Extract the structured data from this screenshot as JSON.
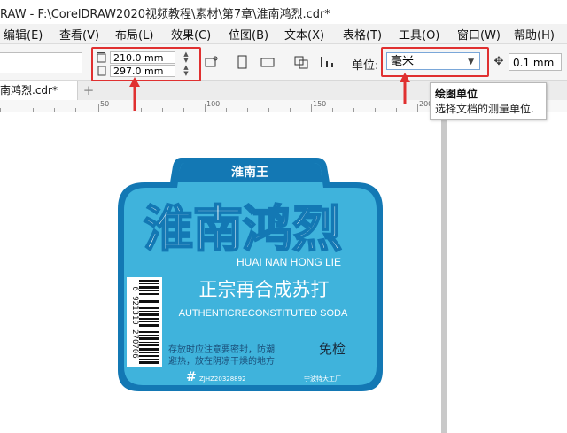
{
  "app": {
    "title": "RAW - F:\\CorelDRAW2020视频教程\\素材\\第7章\\淮南鸿烈.cdr*"
  },
  "menu": [
    {
      "label": "编辑(E)"
    },
    {
      "label": "查看(V)"
    },
    {
      "label": "布局(L)"
    },
    {
      "label": "效果(C)"
    },
    {
      "label": "位图(B)"
    },
    {
      "label": "文本(X)"
    },
    {
      "label": "表格(T)"
    },
    {
      "label": "工具(O)"
    },
    {
      "label": "窗口(W)"
    },
    {
      "label": "帮助(H)"
    }
  ],
  "toolbar": {
    "page_width": "210.0 mm",
    "page_height": "297.0 mm",
    "spin_up": "▲",
    "spin_down": "▼",
    "unit_label": "单位:",
    "unit_value": "毫米",
    "nudge_value": "0.1 mm"
  },
  "tabs": {
    "document_tab": "南鸿烈.cdr*",
    "add_tab": "+"
  },
  "ruler": {
    "ticks": [
      "50",
      "100",
      "150",
      "200"
    ]
  },
  "tooltip": {
    "title": "绘图单位",
    "description": "选择文档的测量单位."
  },
  "label_artwork": {
    "brand_small": "淮南王",
    "brand_main": "淮南鸿烈",
    "brand_pinyin": "HUAI NAN HONG LIE",
    "product_cn": "正宗再合成苏打",
    "product_en": "AUTHENTICRECONSTITUTED SODA",
    "barcode_number": "6 921310 270706",
    "storage_note_1": "存放时应注意要密封，防潮",
    "storage_note_2": "避热，放在阴凉干燥的地方",
    "inspection_free": "免检",
    "footer_code": "ZJHZ20328892",
    "footer_brand": "宁波特大工厂",
    "colors": {
      "outer": "#1378b4",
      "inner": "#3fb3dc",
      "text": "#ffffff",
      "accent": "#e03030"
    }
  }
}
